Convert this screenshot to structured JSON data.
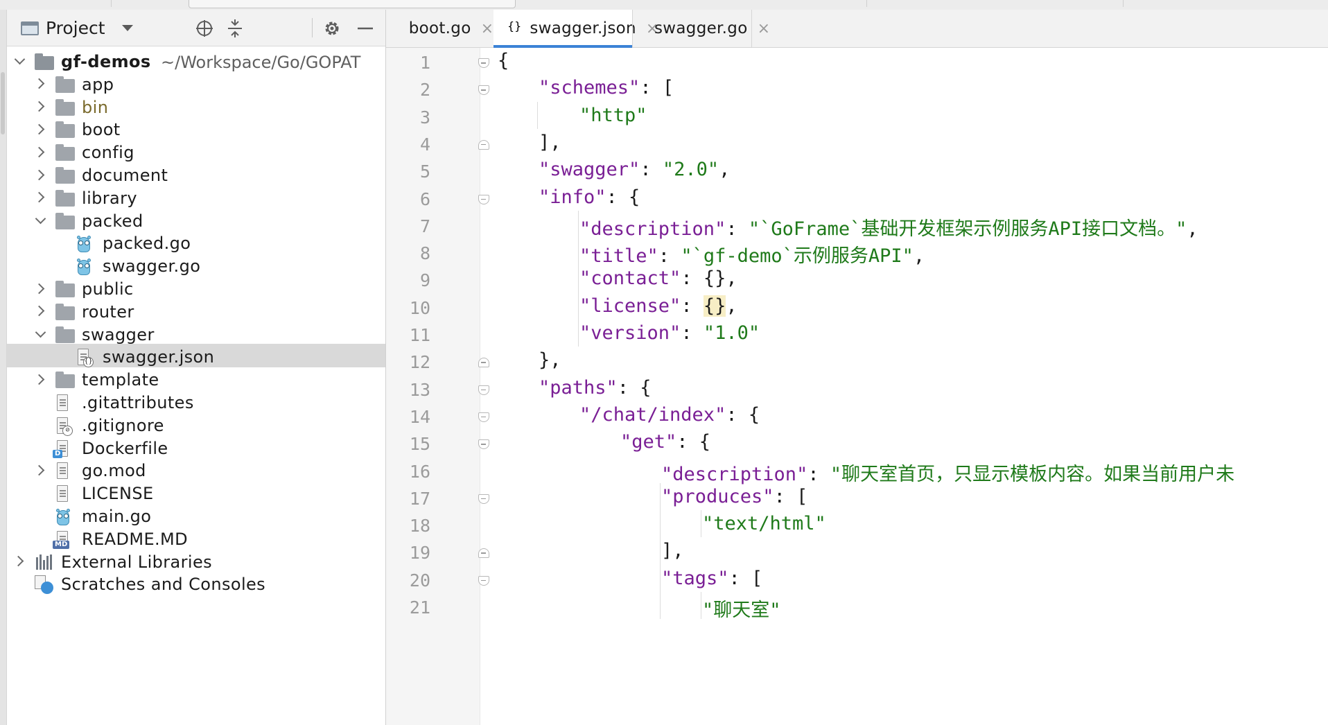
{
  "project_panel": {
    "title": "Project",
    "tools": [
      "locate-icon",
      "collapse-all-icon",
      "gear-icon",
      "minimize-icon"
    ]
  },
  "tree": [
    {
      "label": "gf-demos",
      "path": "~/Workspace/Go/GOPAT",
      "kind": "root",
      "depth": 0,
      "expanded": true
    },
    {
      "label": "app",
      "kind": "folder",
      "depth": 1,
      "expanded": false
    },
    {
      "label": "bin",
      "kind": "folder",
      "depth": 1,
      "expanded": false,
      "muted": true
    },
    {
      "label": "boot",
      "kind": "folder",
      "depth": 1,
      "expanded": false
    },
    {
      "label": "config",
      "kind": "folder",
      "depth": 1,
      "expanded": false
    },
    {
      "label": "document",
      "kind": "folder",
      "depth": 1,
      "expanded": false
    },
    {
      "label": "library",
      "kind": "folder",
      "depth": 1,
      "expanded": false
    },
    {
      "label": "packed",
      "kind": "folder",
      "depth": 1,
      "expanded": true
    },
    {
      "label": "packed.go",
      "kind": "go",
      "depth": 2
    },
    {
      "label": "swagger.go",
      "kind": "go",
      "depth": 2
    },
    {
      "label": "public",
      "kind": "folder",
      "depth": 1,
      "expanded": false
    },
    {
      "label": "router",
      "kind": "folder",
      "depth": 1,
      "expanded": false
    },
    {
      "label": "swagger",
      "kind": "folder",
      "depth": 1,
      "expanded": true
    },
    {
      "label": "swagger.json",
      "kind": "json",
      "depth": 2,
      "selected": true
    },
    {
      "label": "template",
      "kind": "folder",
      "depth": 1,
      "expanded": false
    },
    {
      "label": ".gitattributes",
      "kind": "text",
      "depth": 1
    },
    {
      "label": ".gitignore",
      "kind": "ignore",
      "depth": 1
    },
    {
      "label": "Dockerfile",
      "kind": "docker",
      "depth": 1
    },
    {
      "label": "go.mod",
      "kind": "text",
      "depth": 1,
      "expanded": false,
      "expandable": true
    },
    {
      "label": "LICENSE",
      "kind": "text",
      "depth": 1
    },
    {
      "label": "main.go",
      "kind": "go",
      "depth": 1
    },
    {
      "label": "README.MD",
      "kind": "md",
      "depth": 1
    },
    {
      "label": "External Libraries",
      "kind": "libraries",
      "depth": 0,
      "expanded": false,
      "expandable": true
    },
    {
      "label": "Scratches and Consoles",
      "kind": "scratches",
      "depth": 0
    }
  ],
  "tabs": [
    {
      "label": "boot.go",
      "icon": "gopher-icon",
      "active": false
    },
    {
      "label": "swagger.json",
      "icon": "json-file-icon",
      "active": true
    },
    {
      "label": "swagger.go",
      "icon": "gopher-icon",
      "active": false
    }
  ],
  "tab_close_glyph": "×",
  "badges": {
    "json": "{}",
    "docker": "D",
    "md": "MD",
    "ignore": "⊘"
  },
  "code_lines": [
    {
      "n": "1",
      "indent": 0,
      "fold": "open",
      "tokens": [
        [
          "p",
          "{"
        ]
      ]
    },
    {
      "n": "2",
      "indent": 1,
      "fold": "open",
      "tokens": [
        [
          "k",
          "\"schemes\""
        ],
        [
          "p",
          ": ["
        ]
      ]
    },
    {
      "n": "3",
      "indent": 2,
      "tokens": [
        [
          "s",
          "\"http\""
        ]
      ]
    },
    {
      "n": "4",
      "indent": 1,
      "fold": "close",
      "tokens": [
        [
          "p",
          "],"
        ]
      ]
    },
    {
      "n": "5",
      "indent": 1,
      "tokens": [
        [
          "k",
          "\"swagger\""
        ],
        [
          "p",
          ": "
        ],
        [
          "s",
          "\"2.0\""
        ],
        [
          "p",
          ","
        ]
      ]
    },
    {
      "n": "6",
      "indent": 1,
      "fold": "open",
      "tokens": [
        [
          "k",
          "\"info\""
        ],
        [
          "p",
          ": {"
        ]
      ]
    },
    {
      "n": "7",
      "indent": 2,
      "tokens": [
        [
          "k",
          "\"description\""
        ],
        [
          "p",
          ": "
        ],
        [
          "s",
          "\"`GoFrame`基础开发框架示例服务API接口文档。\""
        ],
        [
          "p",
          ","
        ]
      ]
    },
    {
      "n": "8",
      "indent": 2,
      "tokens": [
        [
          "k",
          "\"title\""
        ],
        [
          "p",
          ": "
        ],
        [
          "s",
          "\"`gf-demo`示例服务API\""
        ],
        [
          "p",
          ","
        ]
      ]
    },
    {
      "n": "9",
      "indent": 2,
      "tokens": [
        [
          "k",
          "\"contact\""
        ],
        [
          "p",
          ": {},"
        ]
      ]
    },
    {
      "n": "10",
      "indent": 2,
      "tokens": [
        [
          "k",
          "\"license\""
        ],
        [
          "p",
          ": "
        ],
        [
          "hl",
          "{}"
        ],
        [
          "p",
          ","
        ]
      ]
    },
    {
      "n": "11",
      "indent": 2,
      "tokens": [
        [
          "k",
          "\"version\""
        ],
        [
          "p",
          ": "
        ],
        [
          "s",
          "\"1.0\""
        ]
      ]
    },
    {
      "n": "12",
      "indent": 1,
      "fold": "close",
      "tokens": [
        [
          "p",
          "},"
        ]
      ]
    },
    {
      "n": "13",
      "indent": 1,
      "fold": "open",
      "tokens": [
        [
          "k",
          "\"paths\""
        ],
        [
          "p",
          ": {"
        ]
      ]
    },
    {
      "n": "14",
      "indent": 2,
      "fold": "open",
      "tokens": [
        [
          "k",
          "\"/chat/index\""
        ],
        [
          "p",
          ": {"
        ]
      ]
    },
    {
      "n": "15",
      "indent": 3,
      "fold": "open",
      "tokens": [
        [
          "k",
          "\"get\""
        ],
        [
          "p",
          ": {"
        ]
      ]
    },
    {
      "n": "16",
      "indent": 4,
      "tokens": [
        [
          "k",
          "\"description\""
        ],
        [
          "p",
          ": "
        ],
        [
          "s",
          "\"聊天室首页，只显示模板内容。如果当前用户未"
        ]
      ]
    },
    {
      "n": "17",
      "indent": 4,
      "fold": "open",
      "tokens": [
        [
          "k",
          "\"produces\""
        ],
        [
          "p",
          ": ["
        ]
      ]
    },
    {
      "n": "18",
      "indent": 5,
      "tokens": [
        [
          "s",
          "\"text/html\""
        ]
      ]
    },
    {
      "n": "19",
      "indent": 4,
      "fold": "close",
      "tokens": [
        [
          "p",
          "],"
        ]
      ]
    },
    {
      "n": "20",
      "indent": 4,
      "fold": "open",
      "tokens": [
        [
          "k",
          "\"tags\""
        ],
        [
          "p",
          ": ["
        ]
      ]
    },
    {
      "n": "21",
      "indent": 5,
      "tokens": [
        [
          "s",
          "\"聊天室\""
        ]
      ]
    }
  ],
  "colors": {
    "key": "#7a1f95",
    "string": "#1f7a1a",
    "punct": "#1b1b1b",
    "line_number": "#9b9b9b",
    "active_tab_underline": "#3b82d6",
    "selection": "#d9d9d9",
    "brace_highlight": "#f7eec5"
  }
}
